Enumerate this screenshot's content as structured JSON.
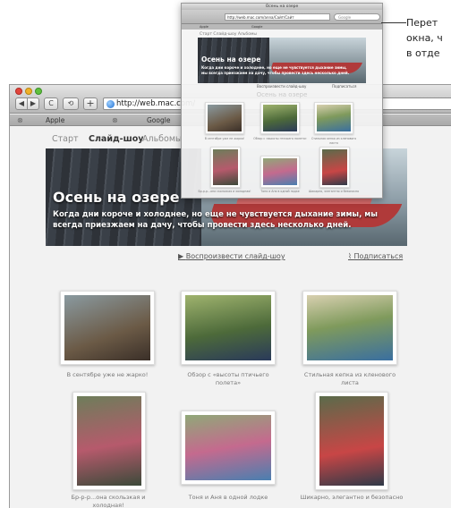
{
  "browser": {
    "url": "http://web.mac.com/",
    "tabs": [
      "Apple",
      "Google"
    ],
    "tab_close_symbol": "⊗",
    "buttons": {
      "back": "◀",
      "forward": "▶",
      "reload": "C",
      "snapback": "⟲",
      "add": "+"
    }
  },
  "site": {
    "nav": [
      "Старт",
      "Слайд-шоу",
      "Альбомы"
    ],
    "hero_title": "Осень на озере",
    "hero_text": "Когда дни короче и холоднее, но еще не чувствуется дыхание зимы, мы всегда приезжаем на дачу, чтобы провести здесь несколько дней.",
    "play_slideshow": "Воспроизвести слайд-шоу",
    "subscribe": "Подписаться",
    "photos": [
      {
        "caption": "В сентябре уже не жарко!"
      },
      {
        "caption": "Обзор с «высоты птичьего полета»"
      },
      {
        "caption": "Стильная кепка из кленового листа"
      },
      {
        "caption": "Бр-р-р...она скользкая и холодная!"
      },
      {
        "caption": "Тоня и Аня в одной лодке"
      },
      {
        "caption": "Шикарно, элегантно и безопасно"
      }
    ]
  },
  "mini_window": {
    "title": "Осень на озере",
    "url": "http://web.mac.com/anna/Сайт/Сайт",
    "search": "Google",
    "tabs": [
      "Apple",
      "Google"
    ],
    "nav": "Старт  Слайд-шоу  Альбомы",
    "ghost_text": "Осень на озере"
  },
  "callout": {
    "lines": [
      "Перет",
      "окна, ч",
      "в отде"
    ]
  },
  "colors": {
    "accent_blue": "#1f6fd1",
    "boat_red": "#b03a3a"
  }
}
